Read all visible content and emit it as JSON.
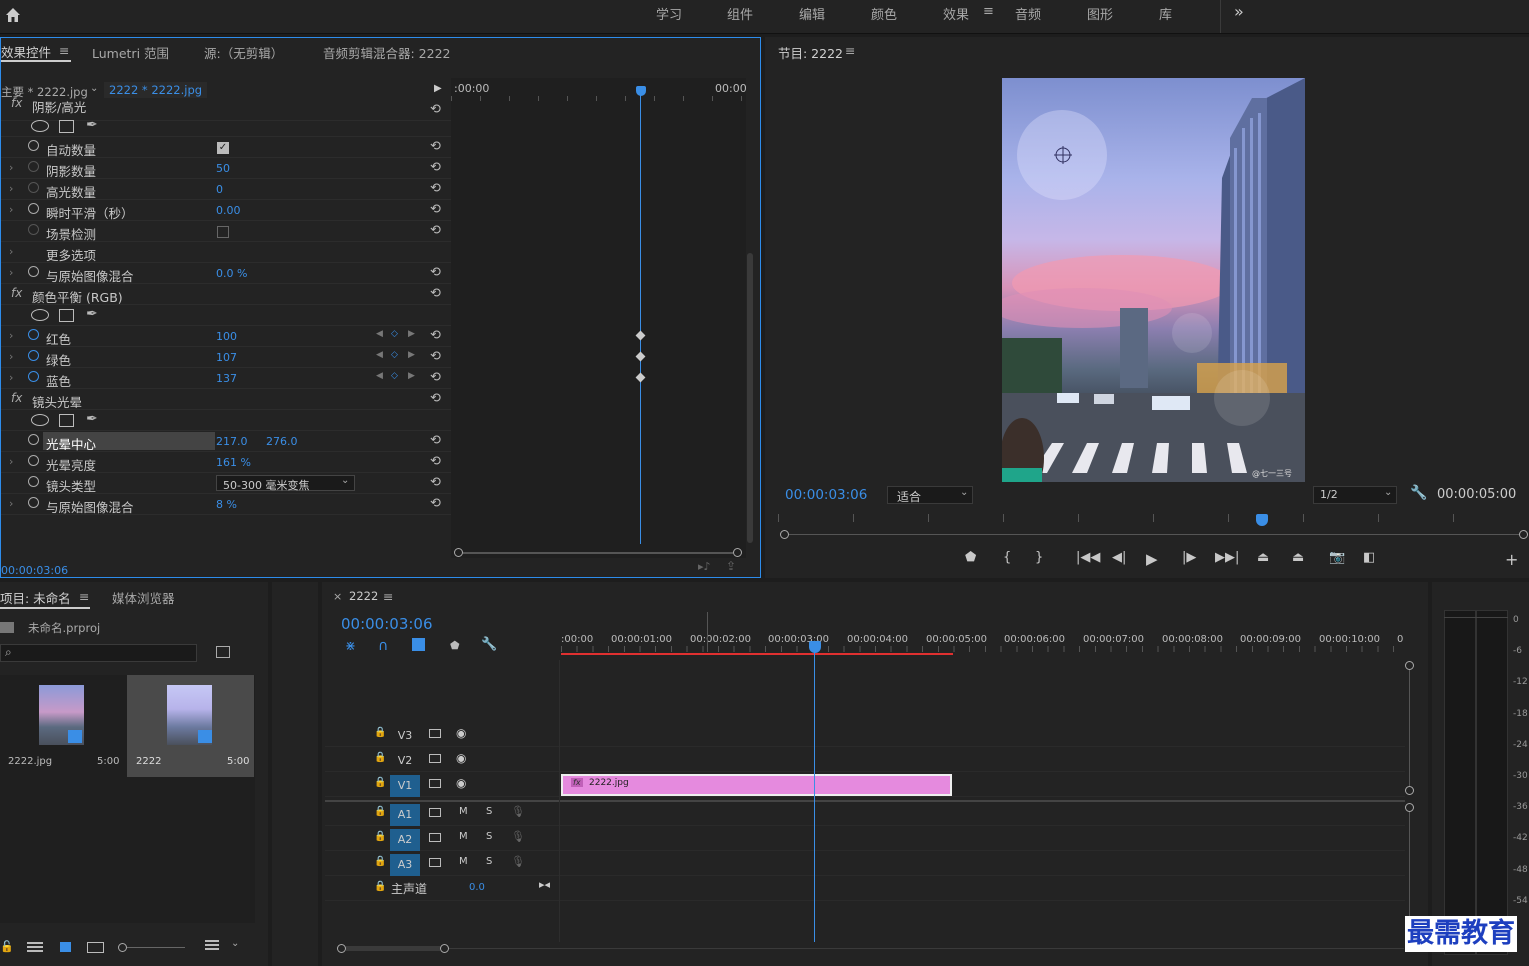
{
  "topbar": {
    "home_icon": "home-icon",
    "workspaces": [
      "学习",
      "组件",
      "编辑",
      "颜色",
      "效果",
      "音频",
      "图形",
      "库"
    ],
    "active": "效果",
    "menu": "≡",
    "more": "»"
  },
  "effect_controls": {
    "tabs": [
      "效果控件",
      "Lumetri 范围",
      "源:（无剪辑）",
      "音频剪辑混合器: 2222"
    ],
    "menu": "≡",
    "clip_master": "主要 * 2222.jpg",
    "clip_seq": "2222 * 2222.jpg",
    "time_start": ":00:00",
    "time_end": "00:00",
    "sections": [
      {
        "name": "阴影/高光",
        "rows": [
          {
            "label": "自动数量",
            "value": "",
            "checkbox": true,
            "checked": true
          },
          {
            "label": "阴影数量",
            "value": "50",
            "disabled": true
          },
          {
            "label": "高光数量",
            "value": "0",
            "disabled": true
          },
          {
            "label": "瞬时平滑（秒）",
            "value": "0.00"
          },
          {
            "label": "场景检测",
            "value": "",
            "checkbox": true,
            "checked": false,
            "disabled": true
          },
          {
            "label": "更多选项",
            "value": ""
          },
          {
            "label": "与原始图像混合",
            "value": "0.0 %"
          }
        ]
      },
      {
        "name": "颜色平衡 (RGB)",
        "rows": [
          {
            "label": "红色",
            "value": "100",
            "keyframe": true
          },
          {
            "label": "绿色",
            "value": "107",
            "keyframe": true
          },
          {
            "label": "蓝色",
            "value": "137",
            "keyframe": true
          }
        ]
      },
      {
        "name": "镜头光晕",
        "rows": [
          {
            "label": "光晕中心",
            "value": "217.0",
            "value2": "276.0",
            "selected": true
          },
          {
            "label": "光晕亮度",
            "value": "161 %"
          },
          {
            "label": "镜头类型",
            "value": "50-300 毫米变焦",
            "dropdown": true
          },
          {
            "label": "与原始图像混合",
            "value": "8 %"
          }
        ]
      }
    ],
    "timecode": "00:00:03:06"
  },
  "program": {
    "title": "节目: 2222",
    "menu": "≡",
    "timecode": "00:00:03:06",
    "fit": "适合",
    "quality": "1/2",
    "duration": "00:00:05:00",
    "watermark": "@七一三号",
    "controls": [
      "marker-icon",
      "mark-in-icon",
      "mark-out-icon",
      "go-to-in-icon",
      "step-back-icon",
      "play-icon",
      "step-forward-icon",
      "go-to-out-icon",
      "lift-icon",
      "extract-icon",
      "export-frame-icon",
      "compare-icon"
    ],
    "add": "+"
  },
  "project": {
    "tabs": [
      "项目: 未命名",
      "媒体浏览器"
    ],
    "menu": "≡",
    "file": "未命名.prproj",
    "items": [
      {
        "name": "2222.jpg",
        "dur": "5:00"
      },
      {
        "name": "2222",
        "dur": "5:00"
      }
    ]
  },
  "timeline": {
    "close": "×",
    "name": "2222",
    "menu": "≡",
    "timecode": "00:00:03:06",
    "ticks": [
      ":00:00",
      "00:00:01:00",
      "00:00:02:00",
      "00:00:03:00",
      "00:00:04:00",
      "00:00:05:00",
      "00:00:06:00",
      "00:00:07:00",
      "00:00:08:00",
      "00:00:09:00",
      "00:00:10:00",
      "0"
    ],
    "video_tracks": [
      "V3",
      "V2",
      "V1"
    ],
    "audio_tracks": [
      "A1",
      "A2",
      "A3"
    ],
    "master": "主声道",
    "master_val": "0.0",
    "clip": "2222.jpg",
    "fx": "fx",
    "mute": "M",
    "solo": "S"
  },
  "meter": {
    "marks": [
      "0",
      "-6",
      "-12",
      "-18",
      "-24",
      "-30",
      "-36",
      "-42",
      "-48",
      "-54"
    ]
  },
  "brand": "最需教育",
  "colors": {
    "accent": "#3a8ee6",
    "clip": "#e58ade",
    "playhead": "#3a8ee6",
    "in_out": "#e03030"
  }
}
